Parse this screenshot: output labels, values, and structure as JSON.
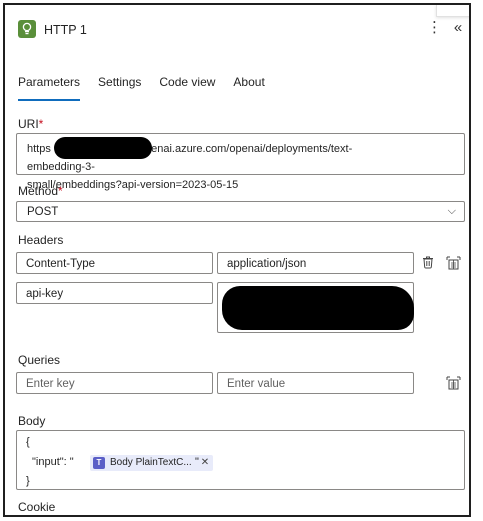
{
  "header": {
    "title": "HTTP 1",
    "app_icon": "lightbulb-icon",
    "more_icon": "more-vertical-icon",
    "collapse_icon": "double-chevron-left-icon",
    "accent_color": "#5a8f3a"
  },
  "tabs": [
    {
      "label": "Parameters",
      "active": true
    },
    {
      "label": "Settings",
      "active": false
    },
    {
      "label": "Code view",
      "active": false
    },
    {
      "label": "About",
      "active": false
    }
  ],
  "uri": {
    "label": "URI",
    "required": "*",
    "value_prefix": "https",
    "value_line1": "openai.azure.com/openai/deployments/text-embedding-3-",
    "value_line2": "small/embeddings?api-version=2023-05-15"
  },
  "method": {
    "label": "Method",
    "required": "*",
    "value": "POST"
  },
  "headers": {
    "label": "Headers",
    "rows": [
      {
        "key": "Content-Type",
        "value": "application/json"
      },
      {
        "key": "api-key",
        "value": ""
      }
    ]
  },
  "queries": {
    "label": "Queries",
    "key_placeholder": "Enter key",
    "value_placeholder": "Enter value"
  },
  "body": {
    "label": "Body",
    "line1": "{",
    "line2_prefix": "\"input\": \"",
    "token_label": "Body PlainTextC...",
    "token_close": "✕",
    "line2_suffix": "\"",
    "line3": "}"
  },
  "cookie": {
    "label": "Cookie"
  },
  "colors": {
    "tab_underline": "#0f6cbd",
    "required_star": "#c50f1f",
    "token_bg": "#e8ebfa",
    "token_icon": "#5b5fc7"
  }
}
